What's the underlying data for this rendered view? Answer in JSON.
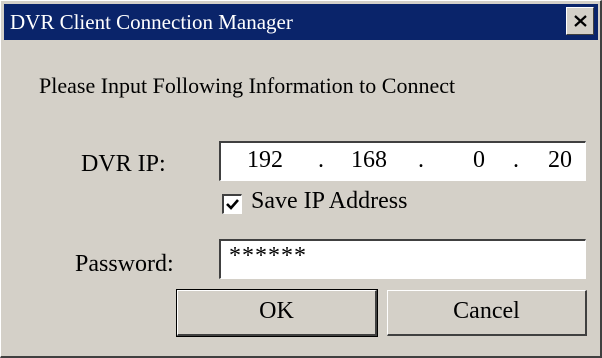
{
  "window": {
    "title": "DVR Client Connection Manager",
    "close_icon": "close-icon"
  },
  "prompt": "Please Input Following Information to Connect",
  "dvr_ip": {
    "label": "DVR IP:",
    "octets": [
      "192",
      "168",
      "0",
      "20"
    ],
    "separator": "."
  },
  "save_ip": {
    "checked": true,
    "label": "Save IP Address"
  },
  "password": {
    "label": "Password:",
    "value": "******"
  },
  "buttons": {
    "ok": "OK",
    "cancel": "Cancel"
  },
  "colors": {
    "titlebar": "#0a246a",
    "face": "#d4d0c8"
  }
}
